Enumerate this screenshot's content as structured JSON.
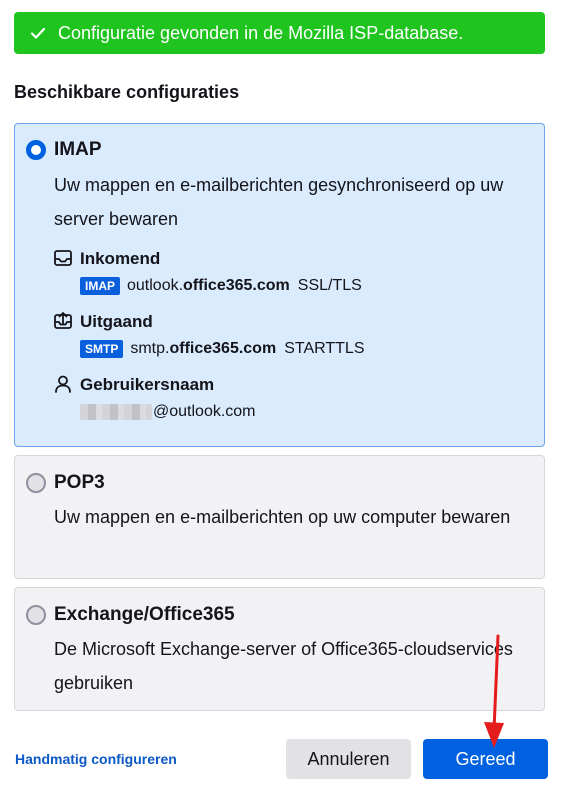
{
  "banner": {
    "icon": "check-icon",
    "text": "Configuratie gevonden in de Mozilla ISP-database."
  },
  "section_title": "Beschikbare configuraties",
  "options": {
    "imap": {
      "title": "IMAP",
      "description": "Uw mappen en e-mailberichten gesynchroniseerd op uw server bewaren",
      "selected": true,
      "incoming": {
        "icon": "inbox-icon",
        "title": "Inkomend",
        "protocol": "IMAP",
        "host_prefix": "outlook.",
        "host_domain": "office365.com",
        "security": "SSL/TLS"
      },
      "outgoing": {
        "icon": "outbox-icon",
        "title": "Uitgaand",
        "protocol": "SMTP",
        "host_prefix": "smtp.",
        "host_domain": "office365.com",
        "security": "STARTTLS"
      },
      "username": {
        "icon": "user-icon",
        "title": "Gebruikersnaam",
        "domain": "@outlook.com"
      }
    },
    "pop3": {
      "title": "POP3",
      "description": "Uw mappen en e-mailberichten op uw computer bewaren",
      "selected": false
    },
    "exchange": {
      "title": "Exchange/Office365",
      "description": "De Microsoft Exchange-server of Office365-cloudservices gebruiken",
      "selected": false
    }
  },
  "footer": {
    "manual_link": "Handmatig configureren",
    "cancel_label": "Annuleren",
    "done_label": "Gereed"
  },
  "colors": {
    "banner": "#1fc41f",
    "accent": "#0061e0",
    "selected_card": "#d9ebfd",
    "annotation_arrow": "#e51c1c"
  }
}
